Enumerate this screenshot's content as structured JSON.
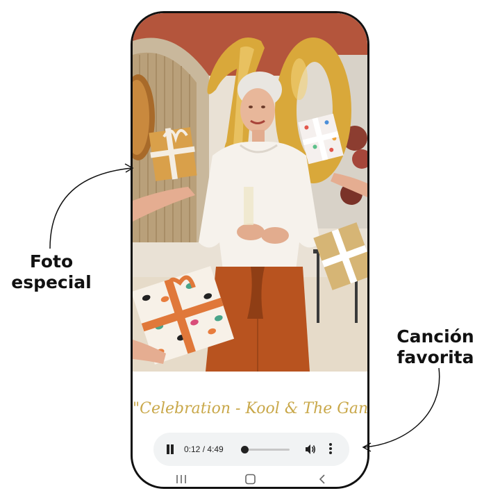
{
  "callouts": {
    "photo_line1": "Foto",
    "photo_line2": "especial",
    "song_line1": "Canción",
    "song_line2": "favorita"
  },
  "song_title": "\"Celebration - Kool & The Gang\"",
  "player": {
    "time": "0:12 / 4:49",
    "progress_fraction": 0.041,
    "play_state_icon": "pause-icon",
    "volume_icon": "volume-icon",
    "menu_icon": "more-vert-icon"
  },
  "navbar": {
    "icons": [
      "recent-apps-icon",
      "home-icon",
      "back-icon"
    ]
  },
  "colors": {
    "song_gold": "#c9a84a",
    "player_bg": "#f1f3f4",
    "wall_terracotta": "#b4553c",
    "balloon_gold": "#d9a83a",
    "pants_rust": "#b8531f"
  }
}
